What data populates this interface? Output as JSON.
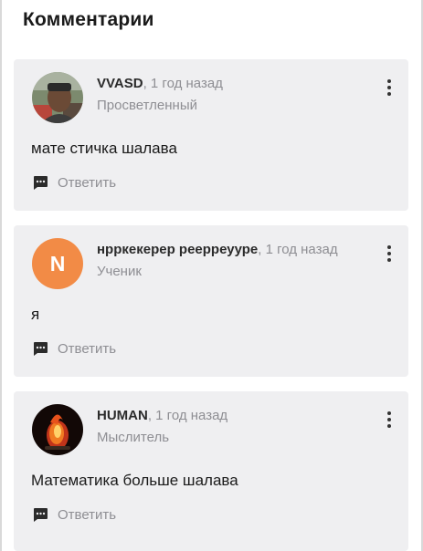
{
  "section": {
    "title": "Комментарии"
  },
  "comments": [
    {
      "author": "VVASD",
      "time": ", 1 год назад",
      "rank": "Просветленный",
      "text": "мате стичка шалава",
      "reply_label": "Ответить",
      "avatar": {
        "type": "photo",
        "icon": "avatar-photo"
      }
    },
    {
      "author": "нрркекерер реерреуурe",
      "time": ", 1 год назад",
      "rank": "Ученик",
      "text": "я",
      "reply_label": "Ответить",
      "avatar": {
        "type": "letter",
        "letter": "N",
        "color": "#f28b46"
      }
    },
    {
      "author": "HUMAN",
      "time": ", 1 год назад",
      "rank": "Мыслитель",
      "text": "Математика больше шалава",
      "reply_label": "Ответить",
      "avatar": {
        "type": "photo",
        "icon": "avatar-photo-fire"
      }
    }
  ],
  "icons": {
    "menu": "more-vertical-icon",
    "reply": "comment-bubble-icon"
  },
  "colors": {
    "card_bg": "#efeff1",
    "muted_text": "#8e8e93",
    "letter_avatar": "#f28b46"
  }
}
